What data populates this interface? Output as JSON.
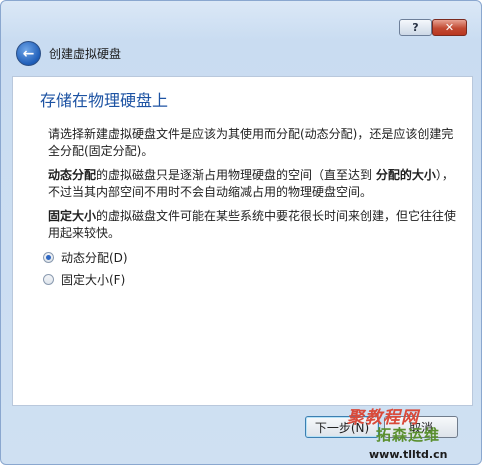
{
  "titlebar": {
    "help_label": "?",
    "close_label": "✕"
  },
  "wizard": {
    "title": "创建虚拟硬盘",
    "back_icon": "back-arrow-icon"
  },
  "page": {
    "heading": "存储在物理硬盘上",
    "intro": "请选择新建虚拟硬盘文件是应该为其使用而分配(动态分配)，还是应该创建完全分配(固定分配)。",
    "dynamic_bold": "动态分配",
    "dynamic_text_1": "的虚拟磁盘只是逐渐占用物理硬盘的空间（直至达到 ",
    "dynamic_bold_2": "分配的大小",
    "dynamic_text_2": "），不过当其内部空间不用时不会自动缩减占用的物理硬盘空间。",
    "fixed_bold": "固定大小",
    "fixed_text": "的虚拟磁盘文件可能在某些系统中要花很长时间来创建，但它往往使用起来较快。"
  },
  "options": [
    {
      "label": "动态分配(D)",
      "selected": true
    },
    {
      "label": "固定大小(F)",
      "selected": false
    }
  ],
  "footer": {
    "next_label": "下一步(N)",
    "cancel_label": "取消"
  },
  "watermark": {
    "line1": "聚教程网",
    "line2": "拓森运维",
    "line3": "www.tlltd.cn"
  },
  "colors": {
    "heading": "#1d53a3",
    "accent": "#2e67c2"
  }
}
